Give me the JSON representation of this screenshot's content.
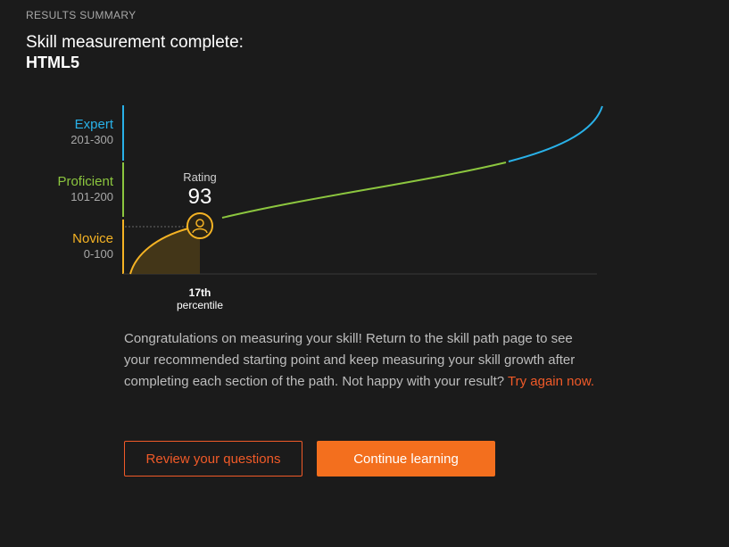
{
  "header": {
    "section_label": "RESULTS SUMMARY",
    "title": "Skill measurement complete:",
    "skill": "HTML5"
  },
  "levels": [
    {
      "name": "Expert",
      "range": "201-300",
      "color": "#29b1e8"
    },
    {
      "name": "Proficient",
      "range": "101-200",
      "color": "#8cc63f"
    },
    {
      "name": "Novice",
      "range": "0-100",
      "color": "#f5b324"
    }
  ],
  "rating": {
    "label": "Rating",
    "value": "93"
  },
  "percentile": {
    "value": "17th",
    "label": "percentile"
  },
  "chart_data": {
    "type": "line",
    "rating": 93,
    "percentile": 17,
    "ylim": [
      0,
      300
    ],
    "xlim": [
      0,
      100
    ],
    "bands": [
      {
        "name": "Novice",
        "from": 0,
        "to": 100,
        "color": "#f5b324"
      },
      {
        "name": "Proficient",
        "from": 101,
        "to": 200,
        "color": "#8cc63f"
      },
      {
        "name": "Expert",
        "from": 201,
        "to": 300,
        "color": "#29b1e8"
      }
    ]
  },
  "message": {
    "text": "Congratulations on measuring your skill! Return to the skill path page to see your recommended starting point and keep measuring your skill growth after completing each section of the path. Not happy with your result?",
    "link": "Try again now."
  },
  "buttons": {
    "review": "Review your questions",
    "continue": "Continue learning"
  },
  "colors": {
    "accent": "#f05a28",
    "button_fill": "#f36f1e",
    "background": "#1b1b1b"
  }
}
